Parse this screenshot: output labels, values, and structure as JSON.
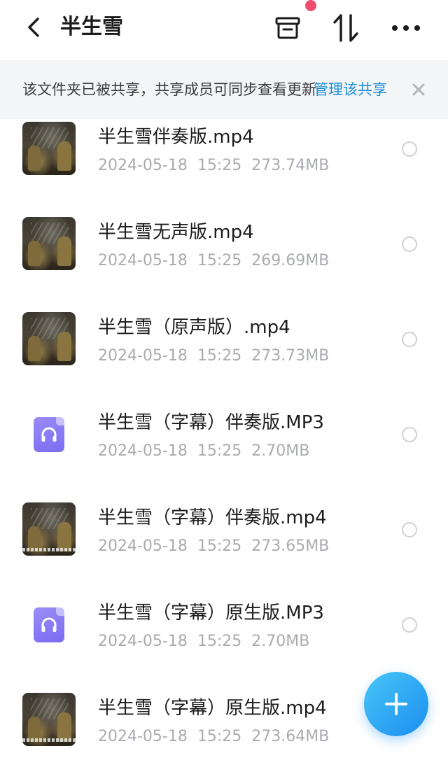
{
  "header": {
    "title": "半生雪",
    "back_icon": "chevron-left-icon",
    "archive_icon": "archive-box-icon",
    "sort_icon": "sort-arrows-icon",
    "more_icon": "more-dots-icon",
    "notification_dot_color": "#ef4d6d"
  },
  "banner": {
    "text": "该文件夹已被共享，共享成员可同步查看更新",
    "link": "管理该共享",
    "close_icon": "close-icon"
  },
  "files": [
    {
      "name": "半生雪伴奏版.mp4",
      "date": "2024-05-18",
      "time": "15:25",
      "size": "273.74MB",
      "type": "video"
    },
    {
      "name": "半生雪无声版.mp4",
      "date": "2024-05-18",
      "time": "15:25",
      "size": "269.69MB",
      "type": "video"
    },
    {
      "name": "半生雪（原声版）.mp4",
      "date": "2024-05-18",
      "time": "15:25",
      "size": "273.73MB",
      "type": "video"
    },
    {
      "name": "半生雪（字幕）伴奏版.MP3",
      "date": "2024-05-18",
      "time": "15:25",
      "size": "2.70MB",
      "type": "audio"
    },
    {
      "name": "半生雪（字幕）伴奏版.mp4",
      "date": "2024-05-18",
      "time": "15:25",
      "size": "273.65MB",
      "type": "video"
    },
    {
      "name": "半生雪（字幕）原生版.MP3",
      "date": "2024-05-18",
      "time": "15:25",
      "size": "2.70MB",
      "type": "audio"
    },
    {
      "name": "半生雪（字幕）原生版.mp4",
      "date": "2024-05-18",
      "time": "15:25",
      "size": "273.64MB",
      "type": "video"
    }
  ],
  "fab": {
    "icon": "plus-icon"
  },
  "colors": {
    "accent": "#1e8fd6",
    "fab": "#1b8ef0",
    "audio_icon": "#7a6cf2"
  }
}
